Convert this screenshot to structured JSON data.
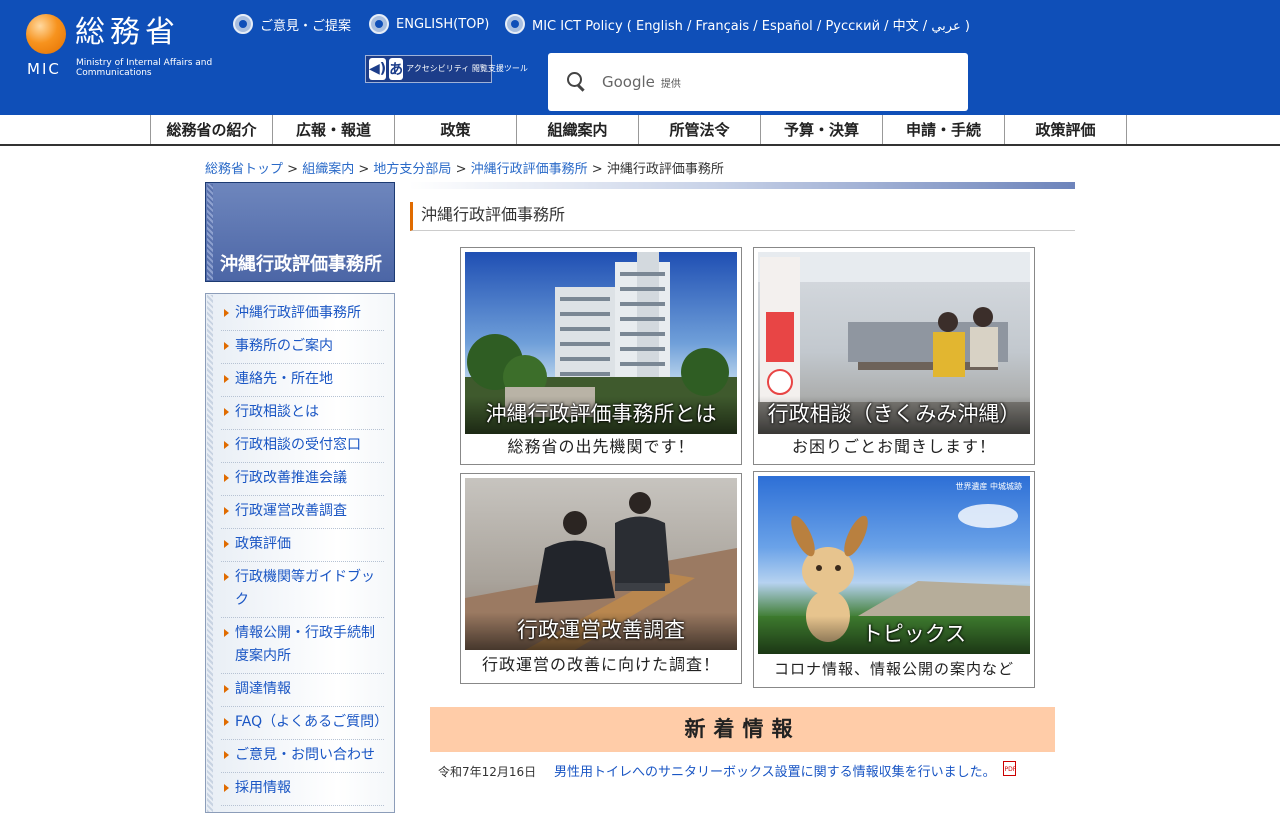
{
  "header": {
    "logo_jp": "総務省",
    "logo_mic": "MIC",
    "logo_en": "Ministry of Internal Affairs and Communications",
    "links": [
      {
        "label": "ご意見・ご提案"
      },
      {
        "label": "ENGLISH(TOP)"
      },
      {
        "label": "MIC ICT Policy ( English / Français / Español / Русский / 中文 / عربي )"
      }
    ],
    "accessibility_label": "アクセシビリティ 閲覧支援ツール",
    "search": {
      "brand": "Google",
      "provided": "提供"
    }
  },
  "global_nav": [
    "総務省の紹介",
    "広報・報道",
    "政策",
    "組織案内",
    "所管法令",
    "予算・決算",
    "申請・手続",
    "政策評価"
  ],
  "breadcrumb": {
    "items": [
      "総務省トップ",
      "組織案内",
      "地方支分部局",
      "沖縄行政評価事務所"
    ],
    "separator": ">",
    "current": "沖縄行政評価事務所"
  },
  "sidebar": {
    "title": "沖縄行政評価事務所",
    "items": [
      {
        "label": "沖縄行政評価事務所"
      },
      {
        "label": "事務所のご案内"
      },
      {
        "label": "連絡先・所在地"
      },
      {
        "label": "行政相談とは"
      },
      {
        "label": "行政相談の受付窓口"
      },
      {
        "label": "行政改善推進会議"
      },
      {
        "label": "行政運営改善調査"
      },
      {
        "label": "政策評価"
      },
      {
        "label": "行政機関等ガイドブック"
      },
      {
        "label": "情報公開・行政手続制度案内所"
      },
      {
        "label": "調達情報"
      },
      {
        "label": "FAQ（よくあるご質問）"
      },
      {
        "label": "ご意見・お問い合わせ"
      },
      {
        "label": "採用情報"
      }
    ]
  },
  "main": {
    "title": "沖縄行政評価事務所",
    "tiles": [
      {
        "title": "沖縄行政評価事務所とは",
        "caption": "総務省の出先機関です！"
      },
      {
        "title": "行政相談（きくみみ沖縄）",
        "caption": "お困りごとお聞きします！"
      },
      {
        "title": "行政運営改善調査",
        "caption": "行政運営の改善に向けた調査！"
      },
      {
        "title": "トピックス",
        "caption": "コロナ情報、情報公開の案内など",
        "badge": "世界遺産 中城城跡"
      }
    ],
    "news": {
      "heading": "新着情報",
      "items": [
        {
          "date": "令和7年12月16日",
          "text": "男性用トイレへのサニタリーボックス設置に関する情報収集を行いました。",
          "file": "PDF"
        }
      ]
    }
  },
  "colors": {
    "header_bg": "#0f4fb8",
    "accent": "#e06b00",
    "news_bg": "#ffcca8",
    "sidebar_title": "#5470ad"
  }
}
